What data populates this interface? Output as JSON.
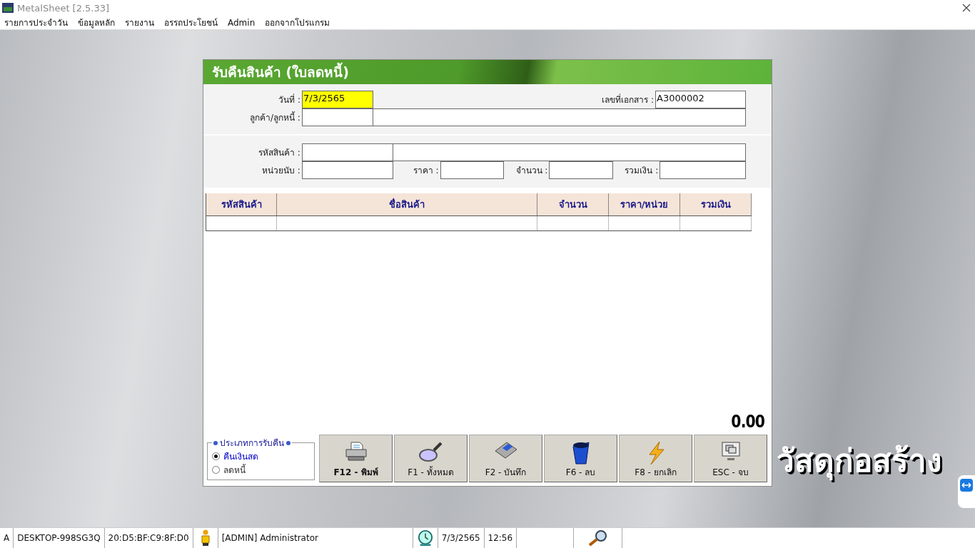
{
  "window": {
    "title": "MetalSheet [2.5.33]"
  },
  "menu": [
    "รายการประจำวัน",
    "ข้อมูลหลัก",
    "รายงาน",
    "อรรถประโยชน์",
    "Admin",
    "ออกจากโปรแกรม"
  ],
  "dialog": {
    "title": "รับคืนสินค้า (ใบลดหนี้)",
    "header_section": [
      {
        "label": "วันที่ :",
        "fields": [
          {
            "value": "7/3/2565",
            "highlighted": true
          }
        ],
        "extra_label": "เลขที่เอกสาร :",
        "extra_fields": [
          {
            "value": "A3000002",
            "highlighted": false
          }
        ]
      },
      {
        "label": "ลูกค้า/ลูกหนี้ :",
        "fields": [
          {
            "highlighted": false
          },
          {
            "highlighted": false
          }
        ]
      }
    ],
    "item_section": [
      {
        "label": "รหัสสินค้า :",
        "fields": [
          {
            "highlighted": false
          },
          {
            "highlighted": false
          }
        ]
      },
      {
        "label": "หน่วยนับ :",
        "fields": [
          {
            "highlighted": false
          }
        ],
        "inline": [
          {
            "label": "ราคา :"
          },
          {
            "label": "จำนวน :"
          },
          {
            "label": "รวมเงิน :"
          }
        ]
      }
    ],
    "table": {
      "columns": [
        "รหัสสินค้า",
        "ชื่อสินค้า",
        "จำนวน",
        "ราคา/หน่วย",
        "รวมเงิน"
      ]
    },
    "total": "0.00",
    "return_type": {
      "legend": "ประเภทการรับคืน",
      "options": [
        {
          "label": "คืนเงินสด",
          "selected": true
        },
        {
          "label": "ลดหนี้",
          "selected": false
        }
      ]
    },
    "buttons": [
      {
        "label": "F12 - พิมพ์",
        "kind": "print",
        "bold": true
      },
      {
        "label": "F1 - ทั้งหมด",
        "kind": "search",
        "bold": false
      },
      {
        "label": "F2 - บันทึก",
        "kind": "save",
        "bold": false
      },
      {
        "label": "F6 - ลบ",
        "kind": "delete",
        "bold": false
      },
      {
        "label": "F8 - ยกเลิก",
        "kind": "cancel",
        "bold": false
      },
      {
        "label": "ESC - จบ",
        "kind": "exit",
        "bold": false
      }
    ]
  },
  "brand_text": "วัสดุก่อสร้าง",
  "status_bar": [
    {
      "kind": "text",
      "text": "A"
    },
    {
      "kind": "text",
      "text": "DESKTOP-998SG3Q"
    },
    {
      "kind": "text",
      "text": "20:D5:BF:C9:8F:D0"
    },
    {
      "kind": "user_icon"
    },
    {
      "kind": "user_text",
      "text": "[ADMIN] Administrator"
    },
    {
      "kind": "clock_icon"
    },
    {
      "kind": "text",
      "text": "7/3/2565"
    },
    {
      "kind": "text",
      "text": "12:56"
    },
    {
      "kind": "search_icon"
    }
  ]
}
